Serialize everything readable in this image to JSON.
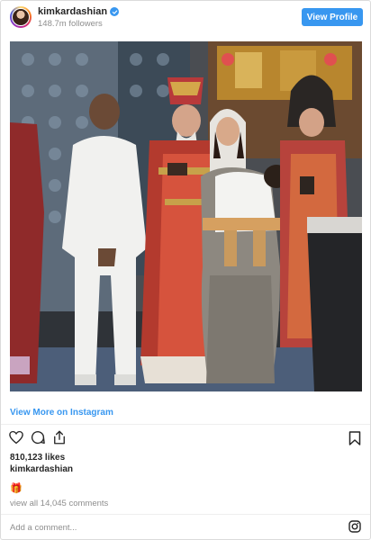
{
  "post": {
    "username": "kimkardashian",
    "followers": "148.7m followers",
    "view_profile_label": "View Profile",
    "view_more_label": "View More on Instagram",
    "likes": "810,123 likes",
    "caption_user": "kimkardashian",
    "caption_emoji": "🎁",
    "view_comments": "view all 14,045 comments",
    "comment_placeholder": "Add a comment..."
  },
  "colors": {
    "accent": "#3897f0",
    "secondary_text": "#8e8e8e",
    "primary_text": "#262626"
  },
  "icons": [
    "verified-badge-icon",
    "heart-icon",
    "comment-icon",
    "share-icon",
    "bookmark-icon",
    "instagram-logo-icon"
  ]
}
